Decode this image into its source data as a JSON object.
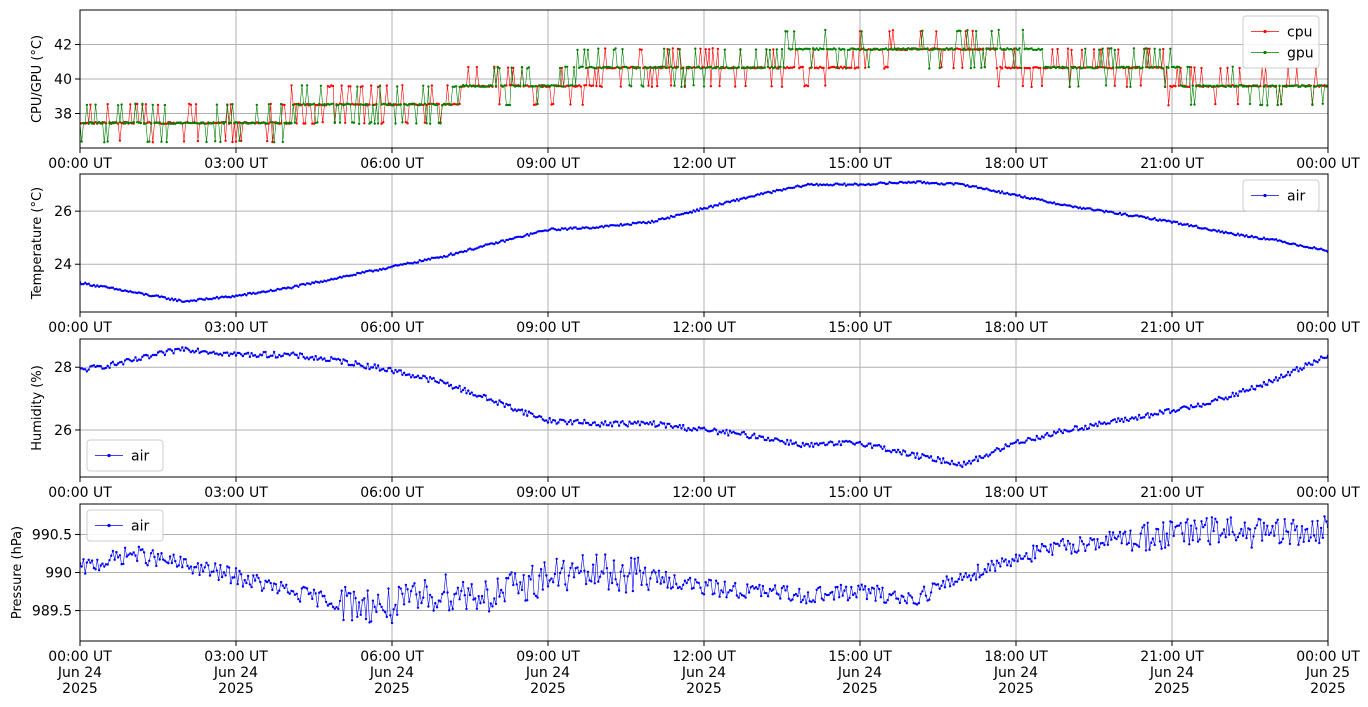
{
  "chart_data": [
    {
      "type": "line",
      "ylabel": "CPU/GPU (°C)",
      "ylim": [
        36.0,
        44.0
      ],
      "yticks": [
        38,
        40,
        42
      ],
      "x_tick_labels": [
        "00:00 UT",
        "03:00 UT",
        "06:00 UT",
        "09:00 UT",
        "12:00 UT",
        "15:00 UT",
        "18:00 UT",
        "21:00 UT",
        "00:00 UT"
      ],
      "x_hours": [
        0,
        1,
        2,
        3,
        4,
        5,
        6,
        7,
        8,
        9,
        10,
        11,
        12,
        13,
        14,
        15,
        16,
        17,
        18,
        19,
        20,
        21,
        22,
        23,
        24
      ],
      "grid": true,
      "legend": "upper right",
      "series": [
        {
          "name": "cpu",
          "color": "#ff0000",
          "values": [
            37.6,
            37.6,
            37.6,
            37.8,
            38.0,
            38.2,
            38.6,
            38.9,
            39.3,
            39.7,
            40.1,
            40.6,
            40.8,
            40.9,
            41.0,
            41.2,
            41.4,
            41.5,
            41.0,
            40.7,
            40.4,
            40.1,
            39.6,
            39.2,
            39.2
          ]
        },
        {
          "name": "gpu",
          "color": "#008000",
          "values": [
            37.6,
            37.6,
            37.5,
            37.6,
            37.9,
            38.4,
            38.7,
            39.0,
            39.4,
            39.9,
            40.3,
            40.8,
            40.9,
            41.1,
            41.3,
            41.6,
            41.8,
            41.9,
            41.4,
            41.0,
            40.6,
            40.2,
            39.7,
            39.3,
            39.3
          ]
        }
      ]
    },
    {
      "type": "line",
      "ylabel": "Temperature (°C)",
      "ylim": [
        22.2,
        27.4
      ],
      "yticks": [
        24,
        26
      ],
      "x_tick_labels": [
        "00:00 UT",
        "03:00 UT",
        "06:00 UT",
        "09:00 UT",
        "12:00 UT",
        "15:00 UT",
        "18:00 UT",
        "21:00 UT",
        "00:00 UT"
      ],
      "x_hours": [
        0,
        1,
        2,
        3,
        4,
        5,
        6,
        7,
        8,
        9,
        10,
        11,
        12,
        13,
        14,
        15,
        16,
        17,
        18,
        19,
        20,
        21,
        22,
        23,
        24
      ],
      "grid": true,
      "legend": "upper right",
      "series": [
        {
          "name": "air",
          "color": "#0000ff",
          "values": [
            23.3,
            22.95,
            22.6,
            22.8,
            23.1,
            23.5,
            23.9,
            24.3,
            24.8,
            25.3,
            25.4,
            25.6,
            26.1,
            26.6,
            27.0,
            27.0,
            27.1,
            27.0,
            26.6,
            26.2,
            25.9,
            25.6,
            25.2,
            24.9,
            24.5
          ]
        }
      ]
    },
    {
      "type": "line",
      "ylabel": "Humidity (%)",
      "ylim": [
        24.5,
        28.9
      ],
      "yticks": [
        26,
        28
      ],
      "x_tick_labels": [
        "00:00 UT",
        "03:00 UT",
        "06:00 UT",
        "09:00 UT",
        "12:00 UT",
        "15:00 UT",
        "18:00 UT",
        "21:00 UT",
        "00:00 UT"
      ],
      "x_hours": [
        0,
        1,
        2,
        3,
        4,
        5,
        6,
        7,
        8,
        9,
        10,
        11,
        12,
        13,
        14,
        15,
        16,
        17,
        18,
        19,
        20,
        21,
        22,
        23,
        24
      ],
      "grid": true,
      "legend": "lower left",
      "series": [
        {
          "name": "air",
          "color": "#0000ff",
          "values": [
            27.9,
            28.2,
            28.6,
            28.4,
            28.4,
            28.2,
            27.9,
            27.5,
            26.9,
            26.3,
            26.2,
            26.2,
            26.0,
            25.8,
            25.5,
            25.6,
            25.2,
            24.9,
            25.6,
            26.0,
            26.3,
            26.6,
            27.0,
            27.6,
            28.4
          ]
        }
      ]
    },
    {
      "type": "line",
      "ylabel": "Pressure (hPa)",
      "ylim": [
        989.1,
        990.9
      ],
      "yticks": [
        989.5,
        990.0,
        990.5
      ],
      "x_tick_labels": [
        "00:00 UT\nJun 24\n2025",
        "03:00 UT\nJun 24\n2025",
        "06:00 UT\nJun 24\n2025",
        "09:00 UT\nJun 24\n2025",
        "12:00 UT\nJun 24\n2025",
        "15:00 UT\nJun 24\n2025",
        "18:00 UT\nJun 24\n2025",
        "21:00 UT\nJun 24\n2025",
        "00:00 UT\nJun 25\n2025"
      ],
      "x_hours": [
        0,
        1,
        2,
        3,
        4,
        5,
        6,
        7,
        8,
        9,
        10,
        11,
        12,
        13,
        14,
        15,
        16,
        17,
        18,
        19,
        20,
        21,
        22,
        23,
        24
      ],
      "grid": true,
      "legend": "upper left",
      "series": [
        {
          "name": "air",
          "color": "#0000ff",
          "values": [
            990.05,
            990.25,
            990.1,
            989.95,
            989.75,
            989.6,
            989.55,
            989.75,
            989.7,
            989.95,
            990.0,
            989.95,
            989.8,
            989.75,
            989.7,
            989.75,
            989.65,
            989.95,
            990.2,
            990.35,
            990.45,
            990.5,
            990.55,
            990.5,
            990.55
          ]
        }
      ]
    }
  ]
}
